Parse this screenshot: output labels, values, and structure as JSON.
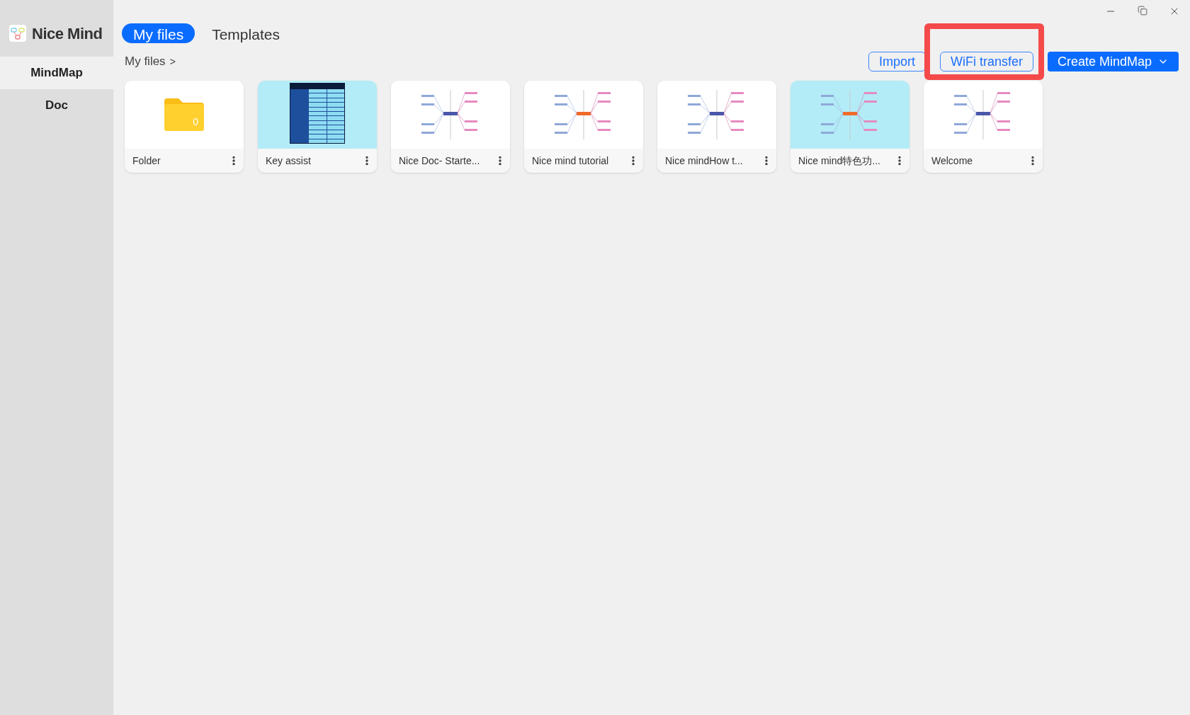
{
  "app": {
    "name": "Nice Mind"
  },
  "sidebar": {
    "items": [
      {
        "label": "MindMap",
        "selected": true
      },
      {
        "label": "Doc",
        "selected": false
      }
    ]
  },
  "tabs": [
    {
      "label": "My files",
      "selected": true
    },
    {
      "label": "Templates",
      "selected": false
    }
  ],
  "breadcrumb": {
    "label": "My files",
    "separator": ">"
  },
  "actions": [
    {
      "label": "Import",
      "kind": "outline",
      "highlighted": false
    },
    {
      "label": "WiFi transfer",
      "kind": "outline",
      "highlighted": true
    },
    {
      "label": "Create MindMap",
      "kind": "primary",
      "highlighted": false
    }
  ],
  "files": [
    {
      "name": "Folder",
      "kind": "folder",
      "count": "0"
    },
    {
      "name": "Key assist",
      "kind": "table",
      "color": "#b3ecf7"
    },
    {
      "name": "Nice Doc- Starte...",
      "kind": "mindmap",
      "color": "#ffffff"
    },
    {
      "name": "Nice mind tutorial",
      "kind": "mindmap",
      "color": "#ffffff"
    },
    {
      "name": "Nice mindHow t...",
      "kind": "mindmap",
      "color": "#ffffff"
    },
    {
      "name": "Nice mind特色功...",
      "kind": "mindmap",
      "color": "#b3ecf7"
    },
    {
      "name": "Welcome",
      "kind": "mindmap",
      "color": "#ffffff"
    }
  ]
}
